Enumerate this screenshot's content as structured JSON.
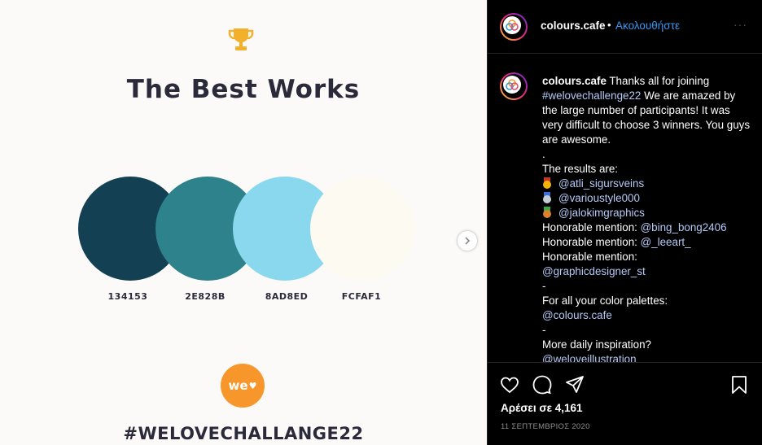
{
  "post_image": {
    "title": "The Best Works",
    "swatches": [
      {
        "color": "#134153",
        "label": "134153"
      },
      {
        "color": "#2E828B",
        "label": "2E828B"
      },
      {
        "color": "#8AD8ED",
        "label": "8AD8ED"
      },
      {
        "color": "#FCFAF1",
        "label": "FCFAF1"
      }
    ],
    "logo_text": "we",
    "hashtag": "#WELOVECHALLANGE22",
    "trophy_icon": "trophy-icon",
    "next_icon": "chevron-right-icon"
  },
  "header": {
    "username": "colours.cafe",
    "separator": "•",
    "follow_label": "Ακολουθήστε",
    "more_label": "···"
  },
  "caption": {
    "username": "colours.cafe",
    "first_text": " Thanks all for joining ",
    "hashtag": "#welovechallenge22",
    "first_rest": " We are amazed by the large number of participants! It was very difficult to choose 3 winners. You guys are awesome.",
    "dot": ".",
    "results_intro": "The results are:",
    "winners": [
      {
        "medal": "gold-medal-icon",
        "handle": "@atli_sigursveins"
      },
      {
        "medal": "silver-medal-icon",
        "handle": "@varioustyle000"
      },
      {
        "medal": "bronze-medal-icon",
        "handle": "@jalokimgraphics"
      }
    ],
    "honorable": [
      {
        "label": "Honorable mention: ",
        "handle": "@bing_bong2406"
      },
      {
        "label": "Honorable mention: ",
        "handle": "@_leeart_"
      },
      {
        "label": "Honorable mention: ",
        "handle": "@graphicdesigner_st"
      }
    ],
    "dash1": "-",
    "palettes_text": "For all your color palettes:",
    "palettes_handle": "@colours.cafe",
    "dash2": "-",
    "inspiration_text": "More daily inspiration?",
    "inspiration_handle": "@weloveillustration"
  },
  "footer": {
    "likes": "Αρέσει σε 4,161",
    "date": "11 ΣΕΠΤΕΜΒΡΙΟΣ 2020",
    "icons": [
      "heart-icon",
      "comment-icon",
      "share-icon",
      "bookmark-icon"
    ]
  },
  "colors": {
    "accent_link": "#3797F0",
    "mention": "#B5C9F5",
    "logo_orange": "#F7972B",
    "title_dark": "#2B2A3A"
  }
}
